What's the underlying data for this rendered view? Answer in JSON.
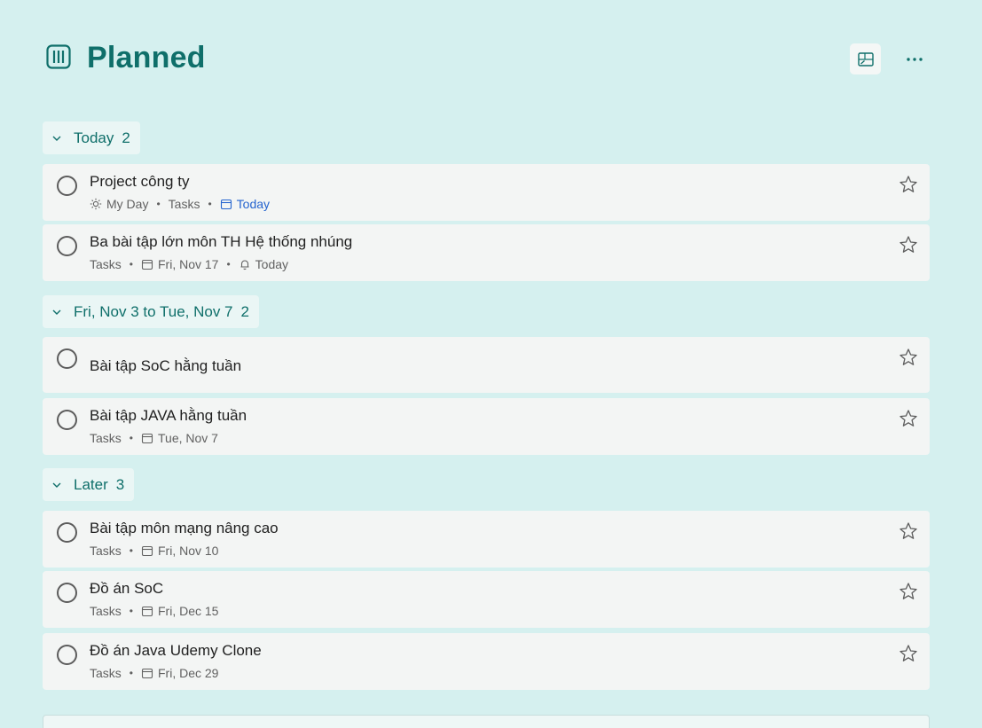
{
  "page": {
    "title": "Planned",
    "icons": {
      "list": "planned-list-icon",
      "suggestions": "suggestions-icon",
      "more": "more-options-icon"
    }
  },
  "colors": {
    "background": "#d5f0ef",
    "accent": "#0f6f6a",
    "task_bg": "#f3f5f4",
    "due_today": "#2564cf"
  },
  "groups": [
    {
      "label": "Today",
      "count": "2",
      "tasks": [
        {
          "name": "Project công ty",
          "meta": {
            "myday": "My Day",
            "list": "Tasks",
            "due": "Today"
          }
        },
        {
          "name": "Ba bài tập lớn môn TH Hệ thống nhúng",
          "meta": {
            "list": "Tasks",
            "due": "Fri, Nov 17",
            "reminder": "Today"
          }
        }
      ]
    },
    {
      "label": "Fri, Nov 3 to Tue, Nov 7",
      "count": "2",
      "tasks": [
        {
          "name": "Bài tập SoC hằng tuần"
        },
        {
          "name": "Bài tập JAVA hằng tuần",
          "meta": {
            "list": "Tasks",
            "due": "Tue, Nov 7"
          }
        }
      ]
    },
    {
      "label": "Later",
      "count": "3",
      "tasks": [
        {
          "name": "Bài tập môn mạng nâng cao",
          "meta": {
            "list": "Tasks",
            "due": "Fri, Nov 10"
          }
        },
        {
          "name": "Đồ án SoC",
          "meta": {
            "list": "Tasks",
            "due": "Fri, Dec 15"
          }
        },
        {
          "name": "Đồ án Java Udemy Clone",
          "meta": {
            "list": "Tasks",
            "due": "Fri, Dec 29"
          }
        }
      ]
    }
  ]
}
